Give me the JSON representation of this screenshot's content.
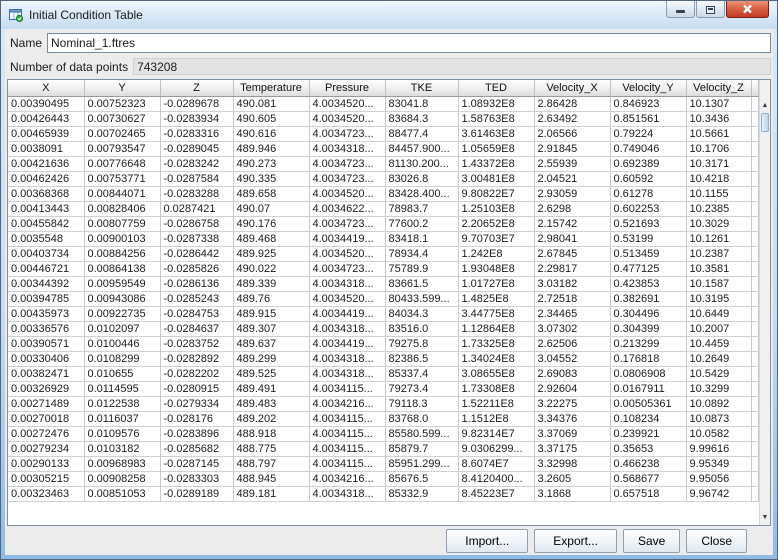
{
  "window": {
    "title": "Initial Condition Table"
  },
  "fields": {
    "name_label": "Name",
    "name_value": "Nominal_1.ftres",
    "points_label": "Number of data points",
    "points_value": "743208"
  },
  "table": {
    "columns": [
      "X",
      "Y",
      "Z",
      "Temperature",
      "Pressure",
      "TKE",
      "TED",
      "Velocity_X",
      "Velocity_Y",
      "Velocity_Z"
    ],
    "rows": [
      [
        "0.00390495",
        "0.00752323",
        "-0.0289678",
        "490.081",
        "4.0034520...",
        "83041.8",
        "1.08932E8",
        "2.86428",
        "0.846923",
        "10.1307"
      ],
      [
        "0.00426443",
        "0.00730627",
        "-0.0283934",
        "490.605",
        "4.0034520...",
        "83684.3",
        "1.58763E8",
        "2.63492",
        "0.851561",
        "10.3436"
      ],
      [
        "0.00465939",
        "0.00702465",
        "-0.0283316",
        "490.616",
        "4.0034723...",
        "88477.4",
        "3.61463E8",
        "2.06566",
        "0.79224",
        "10.5661"
      ],
      [
        "0.0038091",
        "0.00793547",
        "-0.0289045",
        "489.946",
        "4.0034318...",
        "84457.900...",
        "1.05659E8",
        "2.91845",
        "0.749046",
        "10.1706"
      ],
      [
        "0.00421636",
        "0.00776648",
        "-0.0283242",
        "490.273",
        "4.0034723...",
        "81130.200...",
        "1.43372E8",
        "2.55939",
        "0.692389",
        "10.3171"
      ],
      [
        "0.00462426",
        "0.00753771",
        "-0.0287584",
        "490.335",
        "4.0034723...",
        "83026.8",
        "3.00481E8",
        "2.04521",
        "0.60592",
        "10.4218"
      ],
      [
        "0.00368368",
        "0.00844071",
        "-0.0283288",
        "489.658",
        "4.0034520...",
        "83428.400...",
        "9.80822E7",
        "2.93059",
        "0.61278",
        "10.1155"
      ],
      [
        "0.00413443",
        "0.00828406",
        "0.0287421",
        "490.07",
        "4.0034622...",
        "78983.7",
        "1.25103E8",
        "2.6298",
        "0.602253",
        "10.2385"
      ],
      [
        "0.00455842",
        "0.00807759",
        "-0.0286758",
        "490.176",
        "4.0034723...",
        "77600.2",
        "2.20652E8",
        "2.15742",
        "0.521693",
        "10.3029"
      ],
      [
        "0.0035548",
        "0.00900103",
        "-0.0287338",
        "489.468",
        "4.0034419...",
        "83418.1",
        "9.70703E7",
        "2.98041",
        "0.53199",
        "10.1261"
      ],
      [
        "0.00403734",
        "0.00884256",
        "-0.0286442",
        "489.925",
        "4.0034520...",
        "78934.4",
        "1.242E8",
        "2.67845",
        "0.513459",
        "10.2387"
      ],
      [
        "0.00446721",
        "0.00864138",
        "-0.0285826",
        "490.022",
        "4.0034723...",
        "75789.9",
        "1.93048E8",
        "2.29817",
        "0.477125",
        "10.3581"
      ],
      [
        "0.00344392",
        "0.00959549",
        "-0.0286136",
        "489.339",
        "4.0034318...",
        "83661.5",
        "1.01727E8",
        "3.03182",
        "0.423853",
        "10.1587"
      ],
      [
        "0.00394785",
        "0.00943086",
        "-0.0285243",
        "489.76",
        "4.0034520...",
        "80433.599...",
        "1.4825E8",
        "2.72518",
        "0.382691",
        "10.3195"
      ],
      [
        "0.00435973",
        "0.00922735",
        "-0.0284753",
        "489.915",
        "4.0034419...",
        "84034.3",
        "3.44775E8",
        "2.34465",
        "0.304496",
        "10.6449"
      ],
      [
        "0.00336576",
        "0.0102097",
        "-0.0284637",
        "489.307",
        "4.0034318...",
        "83516.0",
        "1.12864E8",
        "3.07302",
        "0.304399",
        "10.2007"
      ],
      [
        "0.00390571",
        "0.0100446",
        "-0.0283752",
        "489.637",
        "4.0034419...",
        "79275.8",
        "1.73325E8",
        "2.62506",
        "0.213299",
        "10.4459"
      ],
      [
        "0.00330406",
        "0.0108299",
        "-0.0282892",
        "489.299",
        "4.0034318...",
        "82386.5",
        "1.34024E8",
        "3.04552",
        "0.176818",
        "10.2649"
      ],
      [
        "0.00382471",
        "0.010655",
        "-0.0282202",
        "489.525",
        "4.0034318...",
        "85337.4",
        "3.08655E8",
        "2.69083",
        "0.0806908",
        "10.5429"
      ],
      [
        "0.00326929",
        "0.0114595",
        "-0.0280915",
        "489.491",
        "4.0034115...",
        "79273.4",
        "1.73308E8",
        "2.92604",
        "0.0167911",
        "10.3299"
      ],
      [
        "0.00271489",
        "0.0122538",
        "-0.0279334",
        "489.483",
        "4.0034216...",
        "79118.3",
        "1.52211E8",
        "3.22275",
        "0.00505361",
        "10.0892"
      ],
      [
        "0.00270018",
        "0.0116037",
        "-0.028176",
        "489.202",
        "4.0034115...",
        "83768.0",
        "1.1512E8",
        "3.34376",
        "0.108234",
        "10.0873"
      ],
      [
        "0.00272476",
        "0.0109576",
        "-0.0283896",
        "488.918",
        "4.0034115...",
        "85580.599...",
        "9.82314E7",
        "3.37069",
        "0.239921",
        "10.0582"
      ],
      [
        "0.00279234",
        "0.0103182",
        "-0.0285682",
        "488.775",
        "4.0034115...",
        "85879.7",
        "9.0306299...",
        "3.37175",
        "0.35653",
        "9.99616"
      ],
      [
        "0.00290133",
        "0.00968983",
        "-0.0287145",
        "488.797",
        "4.0034115...",
        "85951.299...",
        "8.6074E7",
        "3.32998",
        "0.466238",
        "9.95349"
      ],
      [
        "0.00305215",
        "0.00908258",
        "-0.0283303",
        "488.945",
        "4.0034216...",
        "85676.5",
        "8.4120400...",
        "3.2605",
        "0.568677",
        "9.95056"
      ],
      [
        "0.00323463",
        "0.00851053",
        "-0.0289189",
        "489.181",
        "4.0034318...",
        "85332.9",
        "8.45223E7",
        "3.1868",
        "0.657518",
        "9.96742"
      ]
    ]
  },
  "buttons": {
    "import_label": "Import...",
    "export_label": "Export...",
    "save_label": "Save",
    "close_label": "Close"
  },
  "icons": {
    "scroll_up": "▲",
    "scroll_down": "▼",
    "names": [
      "app-table-icon",
      "minimize-icon",
      "maximize-icon",
      "close-icon",
      "scroll-up-icon",
      "scroll-down-icon"
    ]
  },
  "colors": {
    "titlebar_top": "#eef6fd",
    "titlebar_bottom": "#c6dcf0",
    "close_button_red": "#c03a20",
    "frame_blue": "#8fbbe4",
    "scroll_thumb_blue": "#b9d4ec"
  }
}
